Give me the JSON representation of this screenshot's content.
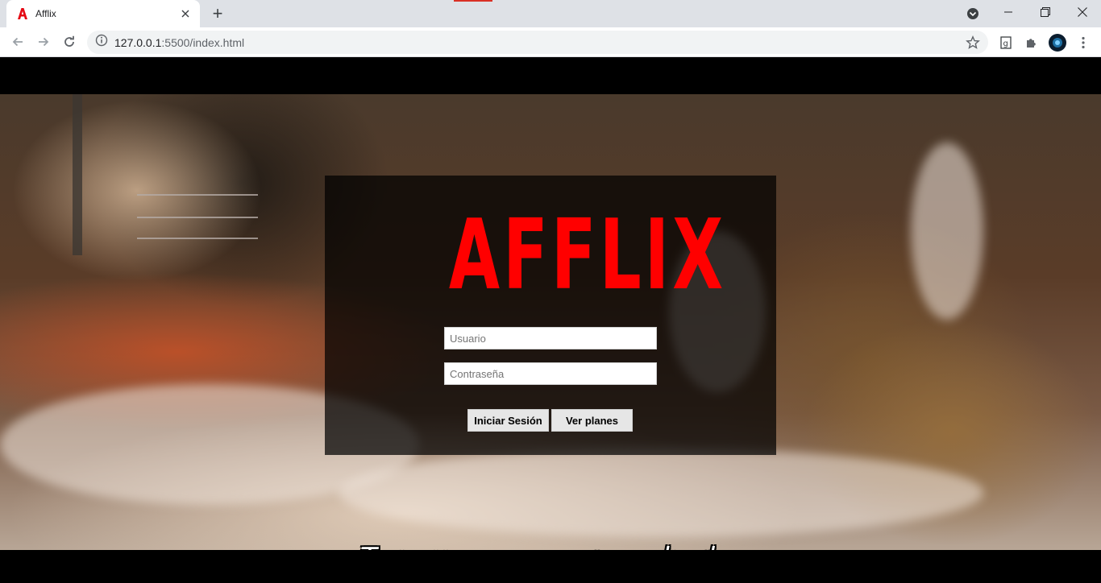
{
  "browser": {
    "tab_title": "Afflix",
    "new_tab_label": "+",
    "url": "127.0.0.1:5500/index.html",
    "url_host": "127.0.0.1",
    "url_rest": ":5500/index.html",
    "favicon_letter": "A",
    "colors": {
      "tabbar": "#dee1e6",
      "favicon": "#e50914"
    }
  },
  "page": {
    "logo": "AFFLIX",
    "username_placeholder": "Usuario",
    "password_placeholder": "Contraseña",
    "login_button": "Iniciar Sesión",
    "plans_button": "Ver planes",
    "subtitle": "Tenemos que aprovecharla.",
    "colors": {
      "logo": "#ff0000",
      "panel": "rgba(0,0,0,0.72)"
    }
  }
}
